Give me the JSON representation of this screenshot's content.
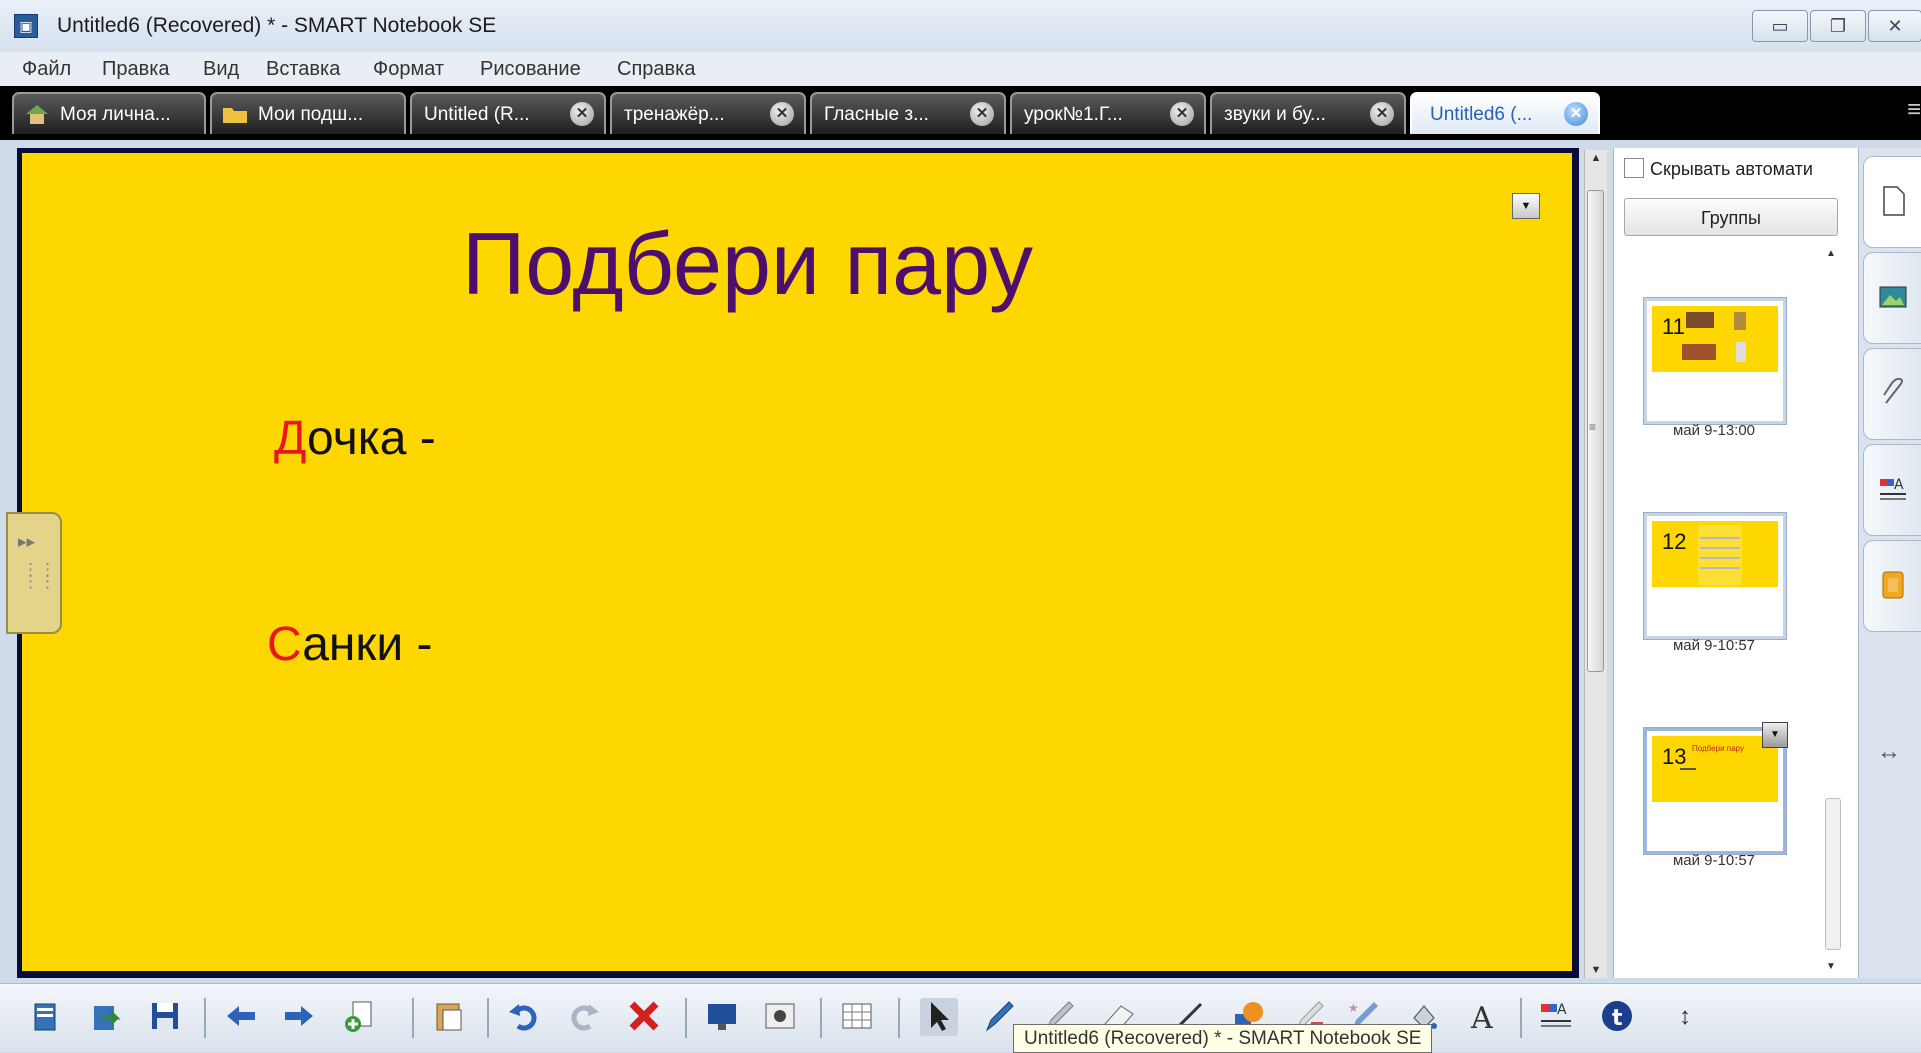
{
  "window": {
    "title": "Untitled6 (Recovered) * - SMART Notebook SE",
    "minimize_glyph": "▭",
    "restore_glyph": "❐",
    "close_glyph": "✕"
  },
  "menu": [
    "Файл",
    "Правка",
    "Вид",
    "Вставка",
    "Формат",
    "Рисование",
    "Справка"
  ],
  "tabs": [
    {
      "label": "Моя лична...",
      "icon": "home-icon"
    },
    {
      "label": "Мои подш...",
      "icon": "folder-icon"
    },
    {
      "label": "Untitled (R...",
      "closable": true
    },
    {
      "label": "тренажёр...",
      "closable": true
    },
    {
      "label": "Гласные з...",
      "closable": true
    },
    {
      "label": "урок№1.Г...",
      "closable": true
    },
    {
      "label": "звуки и бу...",
      "closable": true
    },
    {
      "label": "Untitled6 (...",
      "closable": true,
      "active": true
    }
  ],
  "slide": {
    "title": "Подбери пару",
    "words": [
      {
        "first": "Д",
        "rest": "очка -"
      },
      {
        "first": "С",
        "rest": "анки -"
      }
    ],
    "colors": {
      "background": "#ffd700",
      "title": "#4d0f6e",
      "first_letter": "#e8161e"
    }
  },
  "sorter": {
    "autohide_label": "Скрывать автомати",
    "groups_label": "Группы",
    "pages": [
      {
        "number": "11",
        "date": "май 9-13:00"
      },
      {
        "number": "12",
        "date": "май 9-10:57"
      },
      {
        "number": "13",
        "date": "май 9-10:57",
        "mini_title": "Подбери пару"
      }
    ]
  },
  "right_tabs": [
    "page-sorter-icon",
    "gallery-icon",
    "attachments-icon",
    "properties-icon",
    "addons-icon"
  ],
  "toolbar": {
    "tooltip": "Untitled6 (Recovered) * - SMART Notebook SE",
    "tools": [
      "new-page-icon",
      "open-file-icon",
      "save-icon",
      "back-arrow-icon",
      "forward-arrow-icon",
      "add-page-icon",
      "paste-icon",
      "undo-icon",
      "redo-icon",
      "delete-icon",
      "screen-shade-icon",
      "capture-icon",
      "table-icon",
      "select-icon",
      "pen-icon",
      "creative-pen-icon",
      "eraser-icon",
      "line-icon",
      "shape-icon",
      "magic-pen-icon",
      "fill-icon",
      "text-icon",
      "properties-icon",
      "toolbar-info-icon",
      "toolbar-move-icon"
    ]
  }
}
